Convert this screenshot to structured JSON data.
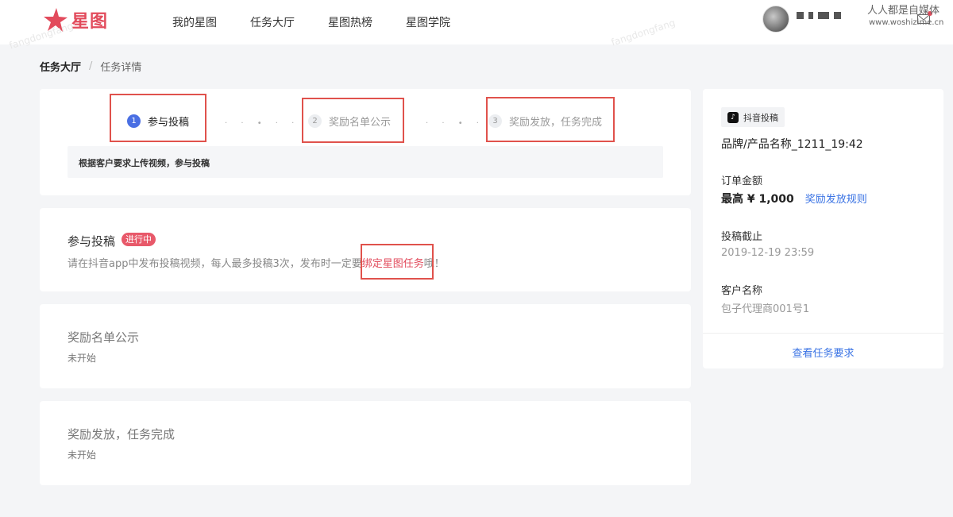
{
  "header": {
    "brand": "星图",
    "nav": [
      "我的星图",
      "任务大厅",
      "星图热榜",
      "星图学院"
    ],
    "watermark_title": "人人都是自媒体",
    "watermark_url": "www.woshizime.cn",
    "faint_watermark": "fangdongfang"
  },
  "breadcrumb": {
    "root": "任务大厅",
    "separator": "/",
    "current": "任务详情"
  },
  "steps": {
    "items": [
      {
        "num": "1",
        "label": "参与投稿"
      },
      {
        "num": "2",
        "label": "奖励名单公示"
      },
      {
        "num": "3",
        "label": "奖励发放，任务完成"
      }
    ],
    "dots_1": "· · • · ·",
    "dots_2": "· · • · ·",
    "description": "根据客户要求上传视频，参与投稿"
  },
  "submit_section": {
    "title": "参与投稿",
    "badge": "进行中",
    "desc_before": "请在抖音app中发布投稿视频，每人最多投稿3次，发布时一定要",
    "desc_link": "绑定星图任务",
    "desc_after": "哦！"
  },
  "reward_section": {
    "title": "奖励名单公示",
    "status": "未开始"
  },
  "finish_section": {
    "title": "奖励发放，任务完成",
    "status": "未开始"
  },
  "info": {
    "platform_tag": "抖音投稿",
    "product_name": "品牌/产品名称_1211_19:42",
    "order_amount_label": "订单金额",
    "order_amount": "最高 ¥ 1,000",
    "reward_rules_link": "奖励发放规则",
    "deadline_label": "投稿截止",
    "deadline": "2019-12-19 23:59",
    "client_label": "客户名称",
    "client": "包子代理商001号1",
    "view_requirements": "查看任务要求"
  },
  "colors": {
    "brand": "#e24b5c",
    "link": "#3a73e4",
    "active_step": "#4a6fe3",
    "highlight_box": "#e0524c"
  }
}
